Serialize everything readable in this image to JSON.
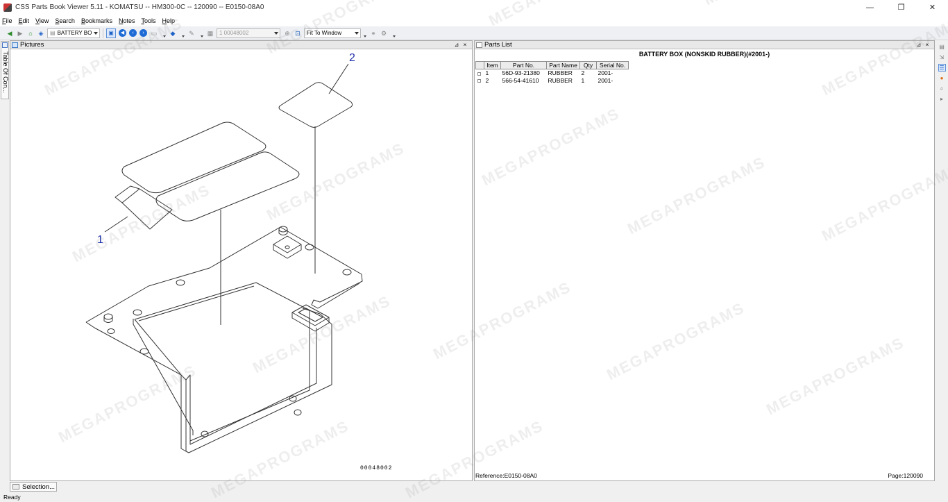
{
  "window": {
    "title": "CSS Parts Book Viewer 5.11 - KOMATSU -- HM300-0C -- 120090 -- E0150-08A0",
    "minimize_glyph": "—",
    "maximize_glyph": "❐",
    "close_glyph": "✕"
  },
  "menu": [
    "File",
    "Edit",
    "View",
    "Search",
    "Bookmarks",
    "Notes",
    "Tools",
    "Help"
  ],
  "toolbar": {
    "book_combo": "BATTERY BO",
    "part_combo": "1 00048002",
    "zoom_combo": "Fit To Window"
  },
  "sidebar": {
    "tab_label": "Table Of Con..."
  },
  "pictures_panel": {
    "title": "Pictures",
    "pin_glyph": "⊿",
    "close_glyph": "×",
    "callout_1": "1",
    "callout_2": "2",
    "drawing_code": "00048002"
  },
  "parts_panel": {
    "title": "Parts List",
    "pin_glyph": "⊿",
    "close_glyph": "×",
    "heading": "BATTERY BOX (NONSKID RUBBER)(#2001-)",
    "columns": [
      "Item",
      "Part No.",
      "Part Name",
      "Qty",
      "Serial No."
    ],
    "rows": [
      {
        "item": "1",
        "part_no": "56D-93-21380",
        "part_name": "RUBBER",
        "qty": "2",
        "serial": "2001-"
      },
      {
        "item": "2",
        "part_no": "566-54-41610",
        "part_name": "RUBBER",
        "qty": "1",
        "serial": "2001-"
      }
    ],
    "reference": "Reference:E0150-08A0",
    "page": "Page:120090"
  },
  "bottom_tab": {
    "label": "Selection..."
  },
  "status": {
    "text": "Ready"
  },
  "watermark_text": "MEGAPROGRAMS",
  "colors": {
    "accent_blue": "#1e62c8",
    "callout_blue": "#2233aa",
    "panel_header": "#e8e8e8"
  }
}
